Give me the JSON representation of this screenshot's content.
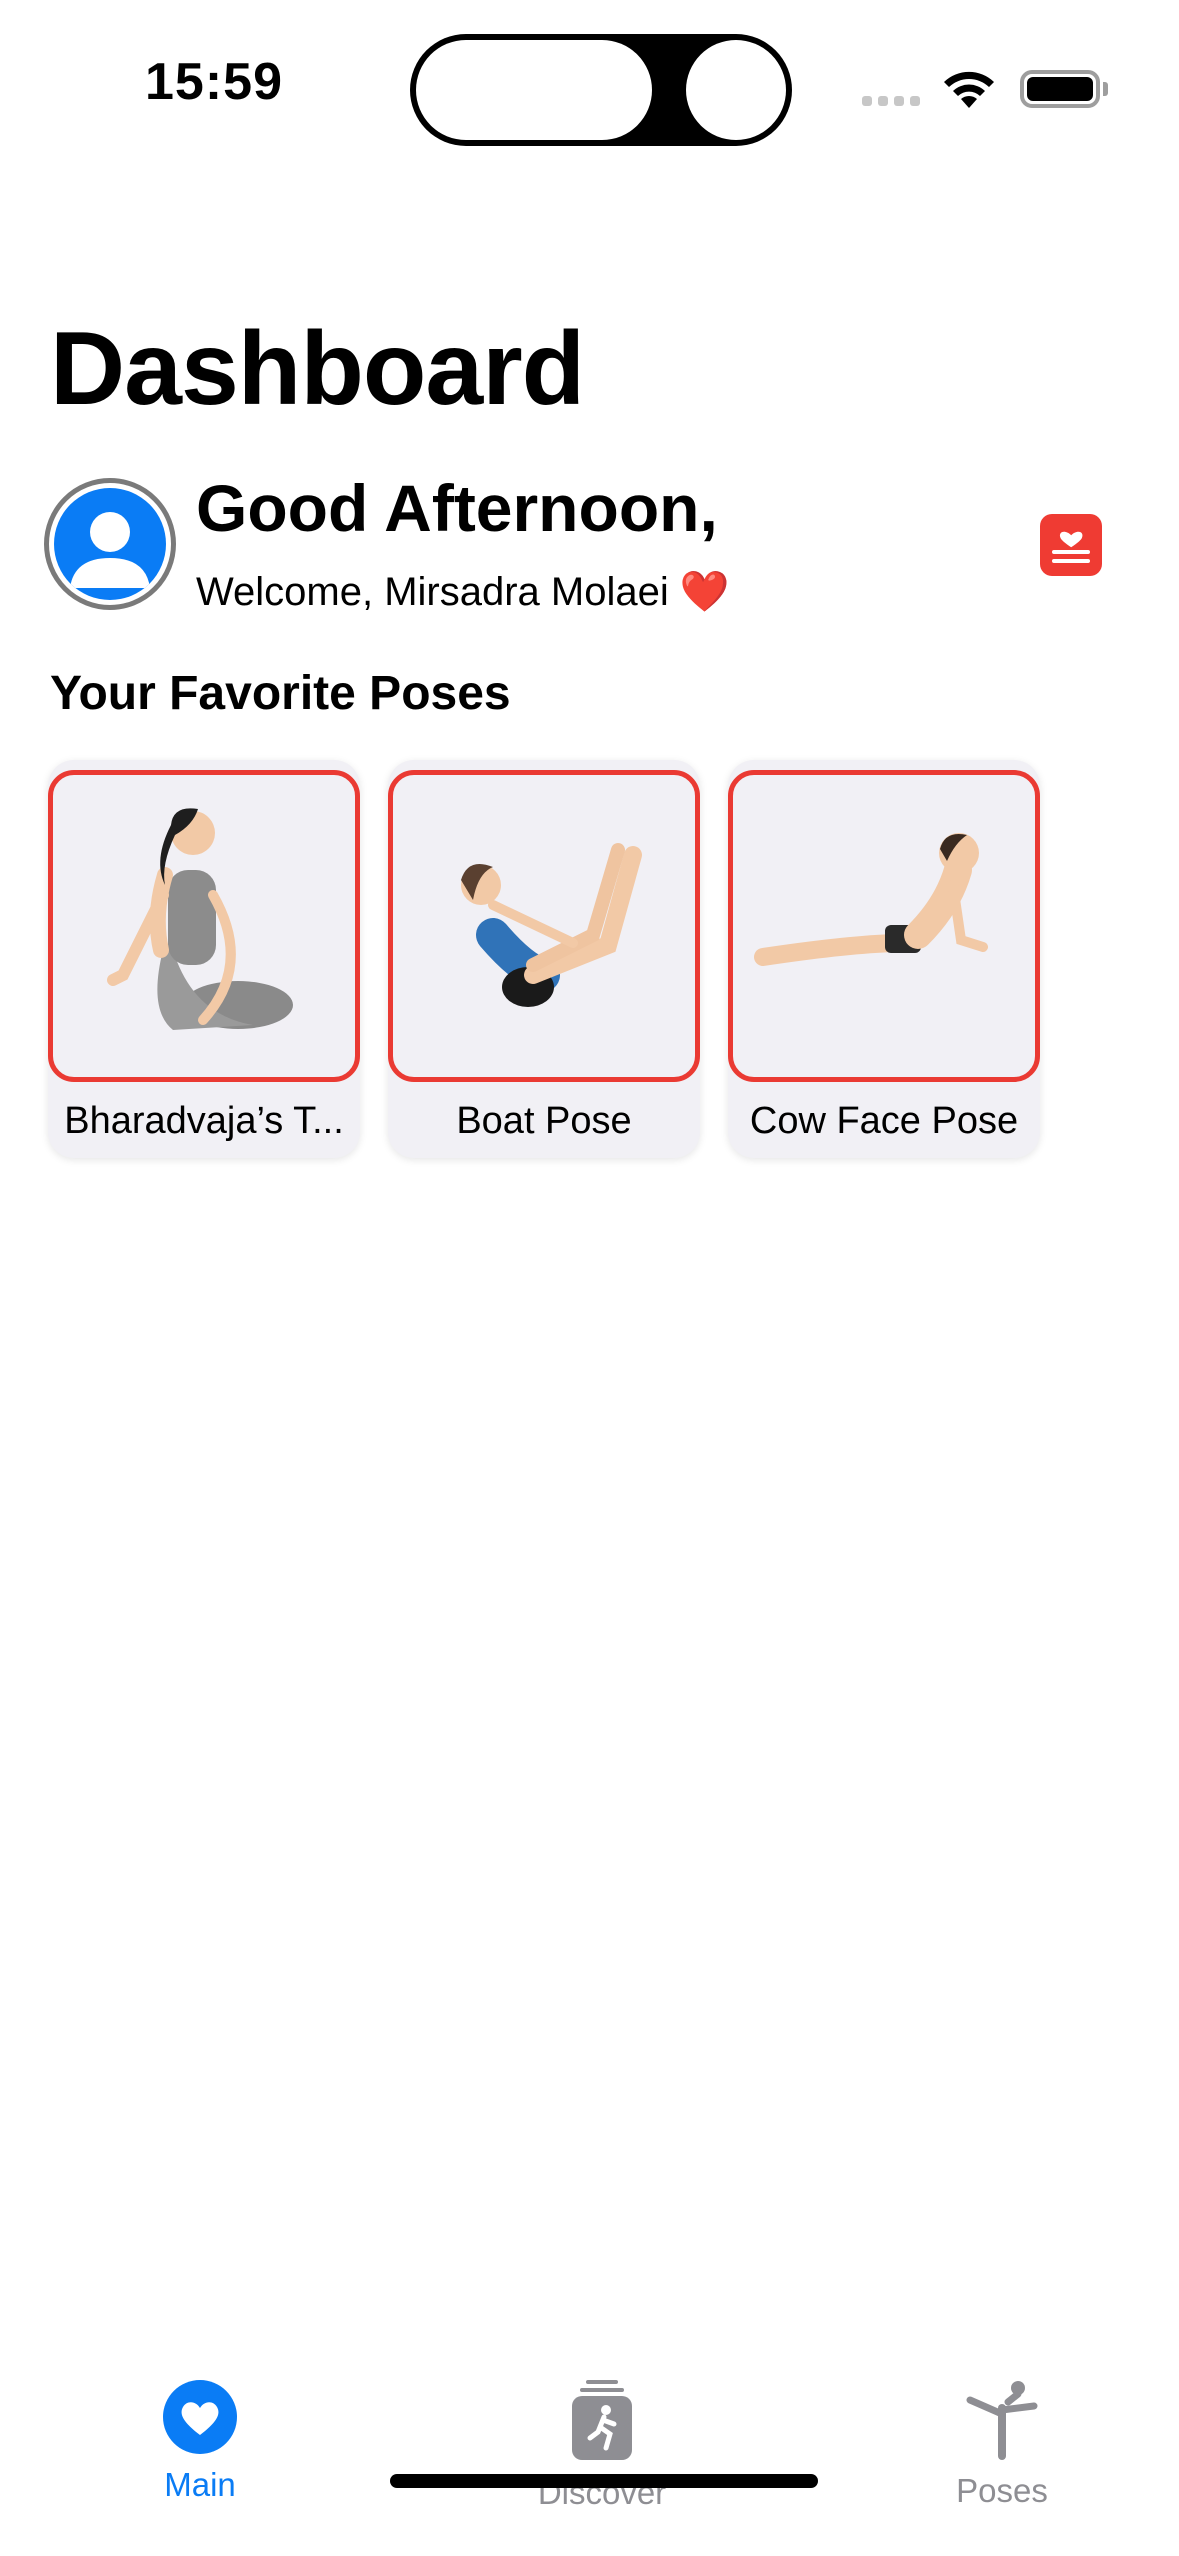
{
  "status_bar": {
    "time": "15:59"
  },
  "header": {
    "title": "Dashboard",
    "greeting": "Good Afternoon,",
    "welcome": "Welcome, Mirsadra Molaei ❤️"
  },
  "favorites": {
    "section_title": "Your Favorite Poses",
    "poses": [
      {
        "name": "Bharadvaja’s T..."
      },
      {
        "name": "Boat Pose"
      },
      {
        "name": "Cow Face Pose"
      }
    ]
  },
  "tab_bar": {
    "tabs": [
      {
        "label": "Main",
        "icon": "heart-icon"
      },
      {
        "label": "Discover",
        "icon": "discover-icon"
      },
      {
        "label": "Poses",
        "icon": "pose-icon"
      }
    ],
    "active_color": "#0a7cf5",
    "inactive_color": "#8e8e93"
  },
  "colors": {
    "accent_red": "#ea3a33",
    "accent_blue": "#0a7cf5"
  }
}
